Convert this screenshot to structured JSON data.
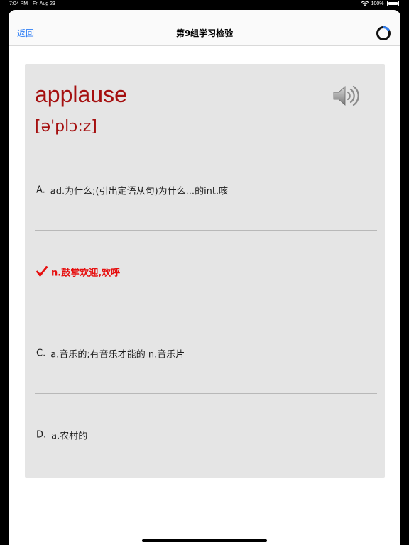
{
  "status_bar": {
    "time": "7:04 PM",
    "date": "Fri Aug 23",
    "battery": "100%"
  },
  "nav": {
    "back_label": "返回",
    "title": "第9组学习检验",
    "progress_icon": "progress-ring-icon"
  },
  "card": {
    "word": "applause",
    "phonetic": "[ə'plɔ:z]",
    "speaker_icon": "speaker-icon"
  },
  "options": [
    {
      "letter": "A.",
      "text": "ad.为什么;(引出定语从句)为什么...的int.咳",
      "correct": false
    },
    {
      "letter": "",
      "text": "n.鼓掌欢迎,欢呼",
      "correct": true
    },
    {
      "letter": "C.",
      "text": "a.音乐的;有音乐才能的 n.音乐片",
      "correct": false
    },
    {
      "letter": "D.",
      "text": "a.农村的",
      "correct": false
    }
  ],
  "colors": {
    "accent": "#2f7ff5",
    "word": "#a50f0f",
    "correct": "#e60f0f",
    "card_bg": "#e5e5e5"
  }
}
